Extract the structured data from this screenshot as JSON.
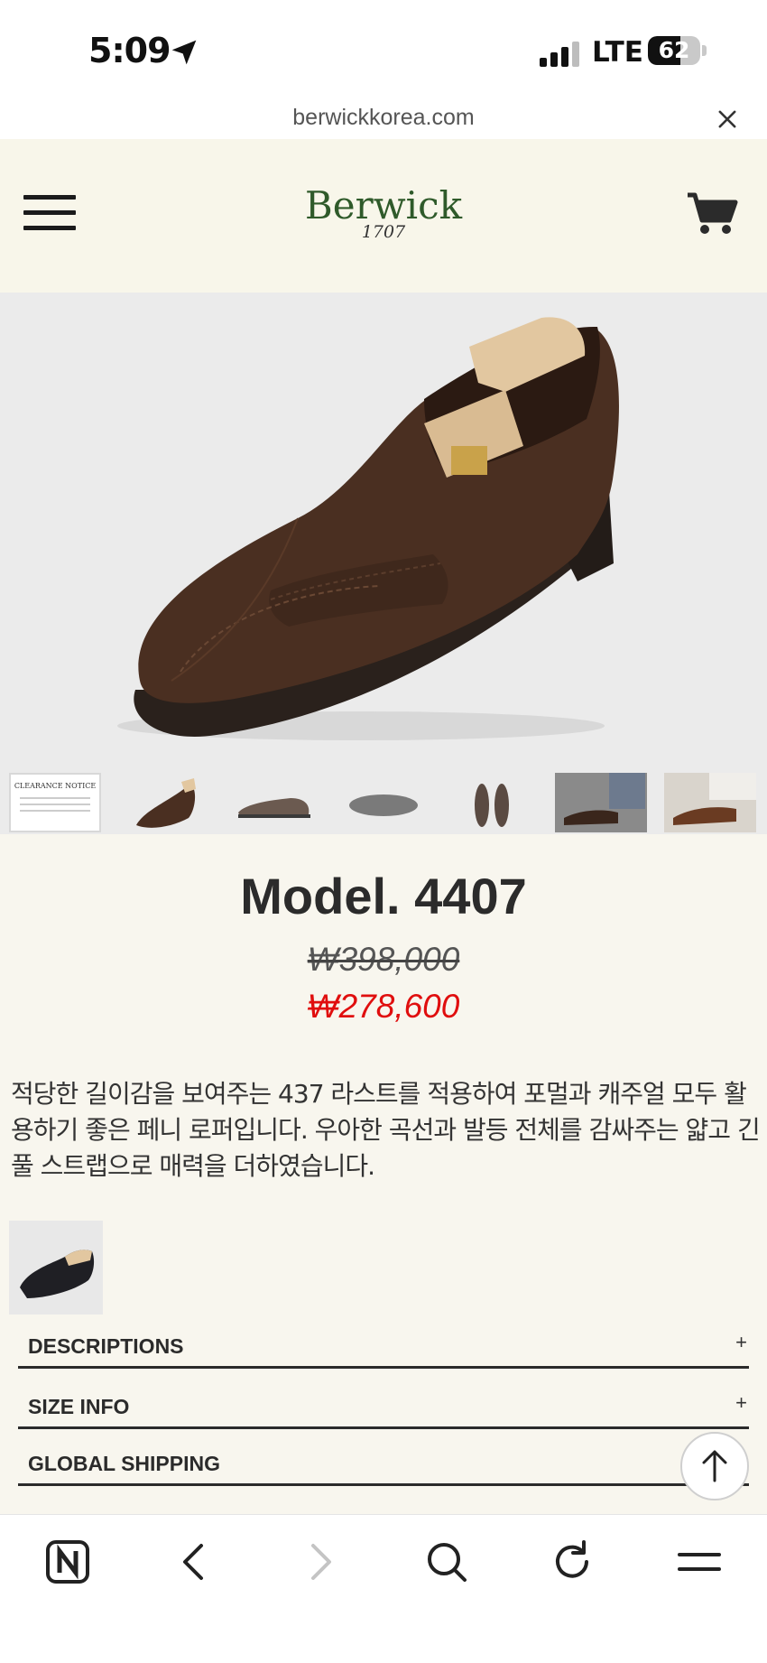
{
  "status_bar": {
    "time": "5:09",
    "network": "LTE",
    "battery": "62",
    "battery_level_percent": 62,
    "icons": [
      "location-arrow-icon",
      "cellular-signal-icon",
      "battery-icon"
    ]
  },
  "browser": {
    "url": "berwickkorea.com",
    "close_icon": "close-icon"
  },
  "header": {
    "logo_name": "Berwick",
    "logo_year": "1707",
    "menu_icon": "hamburger-menu-icon",
    "cart_icon": "shopping-cart-icon"
  },
  "product": {
    "title": "Model. 4407",
    "original_price": "₩398,000",
    "sale_price": "₩278,600",
    "description": " 적당한 길이감을 보여주는 437 라스트를 적용하여 포멀과 캐주얼 모두 활용하기 좋은 페니 로퍼입니다. 우아한 곡선과 발등 전체를 감싸주는 얇고 긴 풀 스트랩으로 매력을 더하였습니다.",
    "gallery_count": 7,
    "thumbnail_notice_title": "CLEARANCE NOTICE"
  },
  "accordion": [
    {
      "label": "DESCRIPTIONS",
      "icon": "+"
    },
    {
      "label": "SIZE INFO",
      "icon": "+"
    },
    {
      "label": "GLOBAL SHIPPING",
      "icon": ""
    }
  ],
  "colors": {
    "page_bg": "#f8f6ee",
    "logo_green": "#2f5a2a",
    "sale_red": "#e00e0e",
    "text_dark": "#2b2b2b"
  },
  "toolbar": {
    "items": [
      "naver-home-icon",
      "back-icon",
      "forward-icon",
      "search-icon",
      "reload-icon",
      "menu-icon"
    ]
  }
}
